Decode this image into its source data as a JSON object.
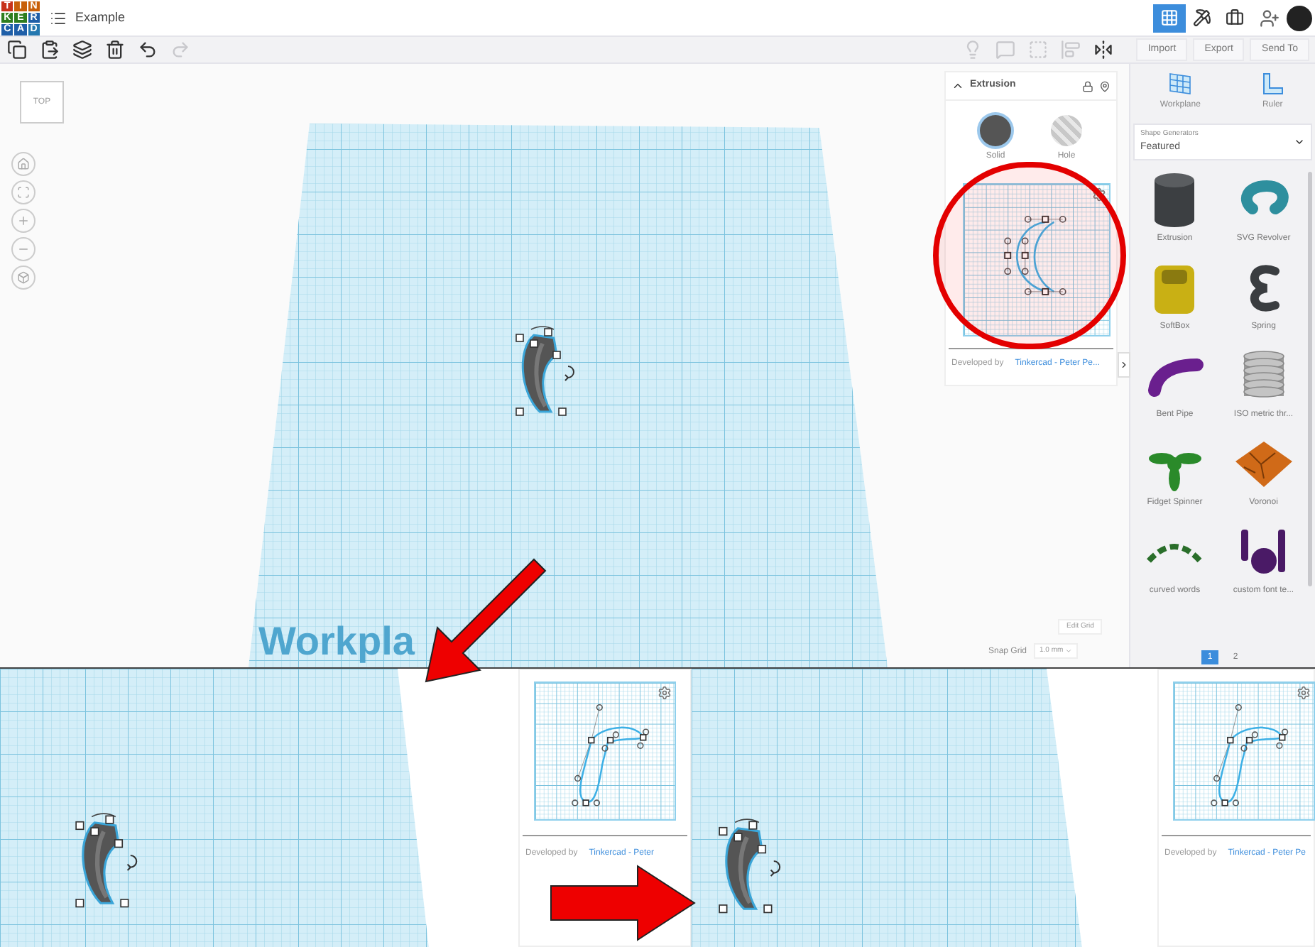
{
  "header": {
    "logo_letters": [
      "T",
      "I",
      "N",
      "K",
      "E",
      "R",
      "C",
      "A",
      "D"
    ],
    "title": "Example",
    "views": [
      {
        "kind": "grid",
        "selected": true
      },
      {
        "kind": "pick",
        "selected": false
      },
      {
        "kind": "bricks",
        "selected": false
      }
    ]
  },
  "toolbar": {
    "edit_tools": [
      {
        "kind": "copy",
        "disabled": false
      },
      {
        "kind": "paste",
        "disabled": false
      },
      {
        "kind": "duplicate",
        "disabled": false
      },
      {
        "kind": "delete",
        "disabled": false
      },
      {
        "kind": "undo",
        "disabled": false
      },
      {
        "kind": "redo",
        "disabled": true
      }
    ],
    "shape_tools": [
      {
        "kind": "bulb",
        "disabled": true
      },
      {
        "kind": "note",
        "disabled": true
      },
      {
        "kind": "outline",
        "disabled": true
      },
      {
        "kind": "align",
        "disabled": true
      },
      {
        "kind": "mirror",
        "disabled": false
      }
    ],
    "buttons": [
      {
        "label": "Import"
      },
      {
        "label": "Export"
      },
      {
        "label": "Send To"
      }
    ]
  },
  "view_cube": {
    "label": "TOP"
  },
  "workplane": {
    "label": "Workpla"
  },
  "grid": {
    "edit_label": "Edit Grid",
    "snap_label": "Snap Grid",
    "snap_value": "1.0 mm"
  },
  "inspector": {
    "title": "Extrusion",
    "modes": [
      {
        "label": "Solid",
        "selected": true
      },
      {
        "label": "Hole",
        "selected": false
      }
    ],
    "credit_label": "Developed by",
    "credit_link": "Tinkercad - Peter Pe..."
  },
  "sidebar": {
    "tools": [
      {
        "kind": "workplane",
        "label": "Workplane"
      },
      {
        "kind": "ruler",
        "label": "Ruler"
      }
    ],
    "category": {
      "label": "Shape Generators",
      "value": "Featured"
    },
    "shapes": [
      {
        "kind": "cylinder",
        "label": "Extrusion"
      },
      {
        "kind": "torus",
        "label": "SVG Revolver"
      },
      {
        "kind": "box",
        "label": "SoftBox"
      },
      {
        "kind": "spring",
        "label": "Spring"
      },
      {
        "kind": "pipe",
        "label": "Bent Pipe"
      },
      {
        "kind": "thread",
        "label": "ISO metric thr..."
      },
      {
        "kind": "spinner",
        "label": "Fidget Spinner"
      },
      {
        "kind": "voronoi",
        "label": "Voronoi"
      },
      {
        "kind": "arc",
        "label": "curved words"
      },
      {
        "kind": "blob",
        "label": "custom font te..."
      }
    ],
    "pages": [
      {
        "label": "1",
        "selected": true
      },
      {
        "label": "2",
        "selected": false
      }
    ]
  },
  "insets": [
    {
      "kind": "workplane"
    },
    {
      "kind": "editor",
      "credit_label": "Developed by",
      "credit_link": "Tinkercad - Peter"
    },
    {
      "kind": "workplane"
    },
    {
      "kind": "editor",
      "credit_label": "Developed by",
      "credit_link": "Tinkercad - Peter Pe"
    }
  ]
}
